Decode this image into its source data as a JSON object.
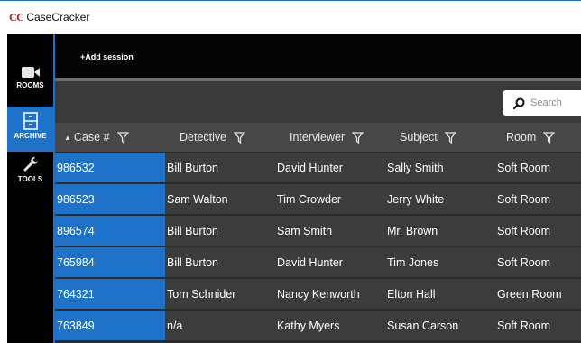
{
  "window": {
    "logo": "CC",
    "title": "CaseCracker"
  },
  "sidebar": {
    "items": [
      {
        "label": "ROOMS",
        "icon": "video-camera-icon"
      },
      {
        "label": "ARCHIVE",
        "icon": "archive-icon"
      },
      {
        "label": "TOOLS",
        "icon": "wrench-icon"
      }
    ]
  },
  "toolbar": {
    "add_session_label": "+Add session"
  },
  "search": {
    "placeholder": "Search"
  },
  "table": {
    "columns": [
      "Case #",
      "Detective",
      "Interviewer",
      "Subject",
      "Room"
    ],
    "sorted_column": "Case #",
    "sort_direction": "ascending",
    "rows": [
      [
        "986532",
        "Bill Burton",
        "David Hunter",
        "Sally Smith",
        "Soft Room"
      ],
      [
        "986523",
        "Sam Walton",
        "Tim Crowder",
        "Jerry White",
        "Soft Room"
      ],
      [
        "896574",
        "Bill Burton",
        "Sam Smith",
        "Mr. Brown",
        "Soft Room"
      ],
      [
        "765984",
        "Bill Burton",
        "David Hunter",
        "Tim Jones",
        "Soft Room"
      ],
      [
        "764321",
        "Tom Schnider",
        "Nancy Kenworth",
        "Elton Hall",
        "Green Room"
      ],
      [
        "763849",
        "n/a",
        "Kathy Myers",
        "Susan Carson",
        "Soft Room"
      ]
    ]
  },
  "colors": {
    "accent": "#1e73c8",
    "logo_red": "#c0161c",
    "background": "#000000",
    "row_background": "#3c3c3c",
    "header_background": "#474747"
  }
}
